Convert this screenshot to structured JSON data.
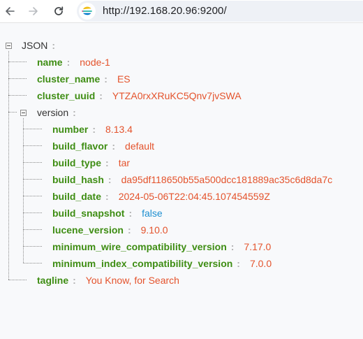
{
  "browser": {
    "url": "http://192.168.20.96:9200/",
    "site_icon": "elastic-logo-icon"
  },
  "tree": {
    "root_label": "JSON",
    "colon": ":",
    "name": {
      "key": "name",
      "value": "node-1"
    },
    "cluster_name": {
      "key": "cluster_name",
      "value": "ES"
    },
    "cluster_uuid": {
      "key": "cluster_uuid",
      "value": "YTZA0rxXRuKC5Qnv7jvSWA"
    },
    "version": {
      "key": "version",
      "number": {
        "key": "number",
        "value": "8.13.4"
      },
      "build_flavor": {
        "key": "build_flavor",
        "value": "default"
      },
      "build_type": {
        "key": "build_type",
        "value": "tar"
      },
      "build_hash": {
        "key": "build_hash",
        "value": "da95df118650b55a500dcc181889ac35c6d8da7c"
      },
      "build_date": {
        "key": "build_date",
        "value": "2024-05-06T22:04:45.107454559Z"
      },
      "build_snapshot": {
        "key": "build_snapshot",
        "value": "false"
      },
      "lucene_version": {
        "key": "lucene_version",
        "value": "9.10.0"
      },
      "minimum_wire_compatibility_version": {
        "key": "minimum_wire_compatibility_version",
        "value": "7.17.0"
      },
      "minimum_index_compatibility_version": {
        "key": "minimum_index_compatibility_version",
        "value": "7.0.0"
      }
    },
    "tagline": {
      "key": "tagline",
      "value": "You Know, for Search"
    }
  },
  "colors": {
    "key": "#3e8d13",
    "string": "#e4532c",
    "boolean": "#1e8fd0"
  }
}
